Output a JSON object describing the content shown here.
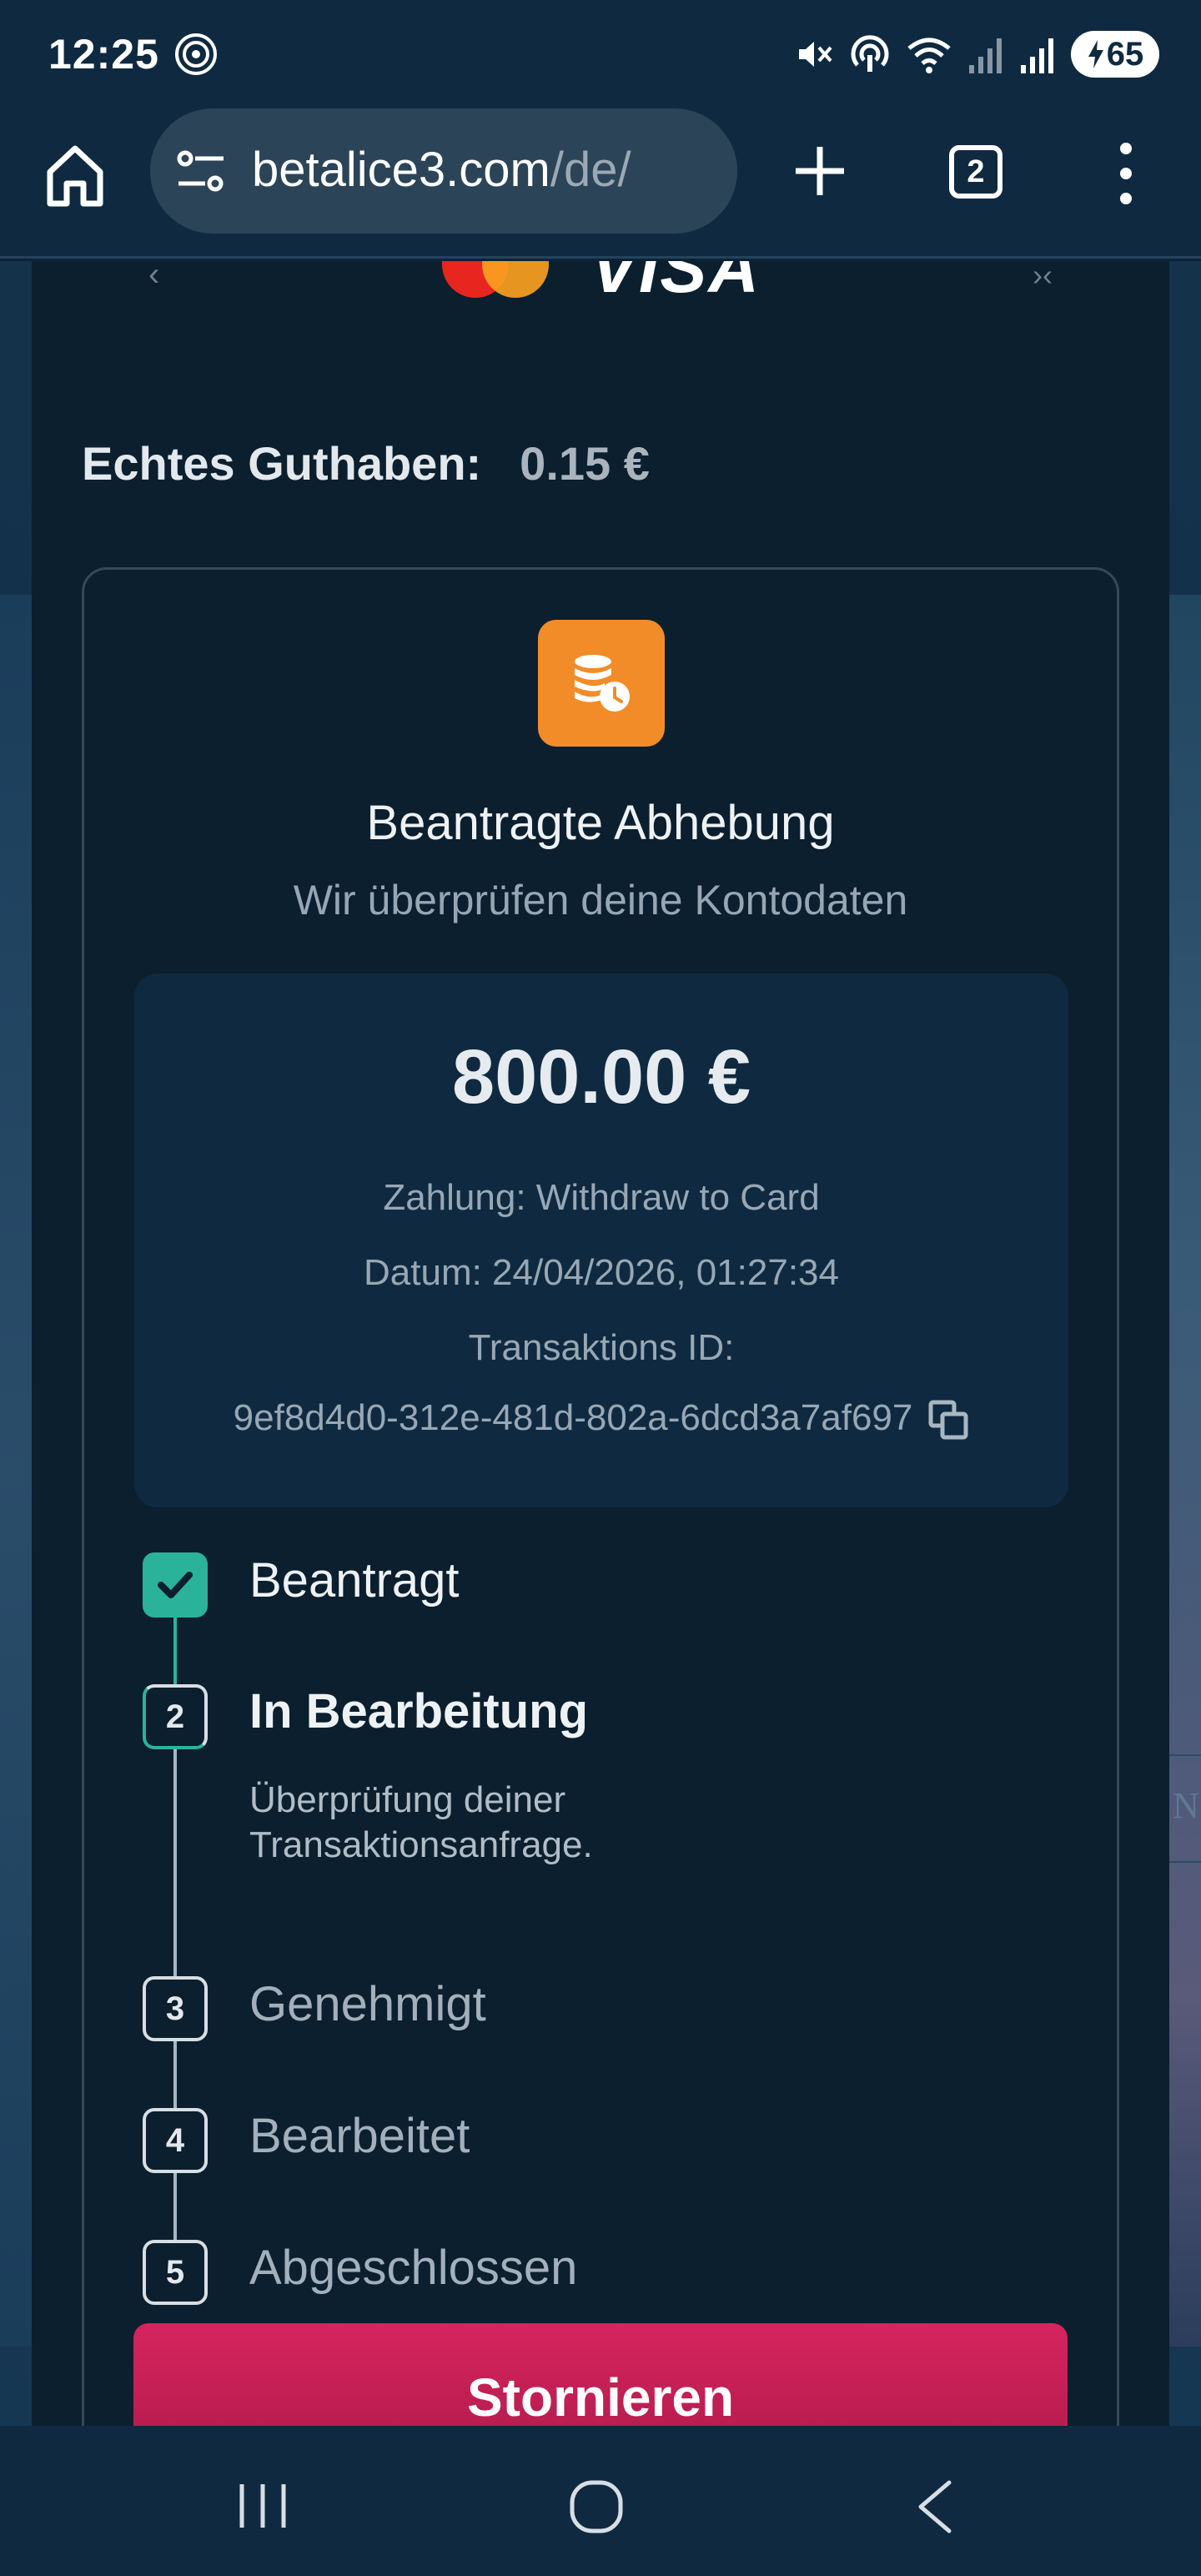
{
  "status_bar": {
    "time": "12:25",
    "battery": "65",
    "icons": [
      "hotspot-icon",
      "mute-icon",
      "nfc-icon",
      "wifi-icon",
      "signal-icon",
      "signal-r-icon",
      "battery-charging-icon"
    ]
  },
  "browser": {
    "url_domain": "betalice3.com",
    "url_path": "/de/",
    "tab_count": "2",
    "icons": [
      "home-icon",
      "site-settings-icon",
      "new-tab-icon",
      "more-menu-icon"
    ]
  },
  "header_logos": {
    "visa_text": "VISA"
  },
  "balance": {
    "label": "Echtes Guthaben:",
    "value": "0.15 €"
  },
  "withdrawal": {
    "icon": "coins-clock-icon",
    "title": "Beantragte Abhebung",
    "subtitle": "Wir überprüfen deine Kontodaten",
    "amount": "800.00 €",
    "payment": "Zahlung: Withdraw to Card",
    "date": "Datum: 24/04/2026, 01:27:34",
    "txn_label": "Transaktions ID:",
    "txn_id": "9ef8d4d0-312e-481d-802a-6dcd3a7af697"
  },
  "steps": [
    {
      "number": "",
      "label": "Beantragt",
      "state": "done"
    },
    {
      "number": "2",
      "label": "In Bearbeitung",
      "state": "active",
      "description": "Überprüfung deiner Transaktionsanfrage."
    },
    {
      "number": "3",
      "label": "Genehmigt",
      "state": "pending"
    },
    {
      "number": "4",
      "label": "Bearbeitet",
      "state": "pending"
    },
    {
      "number": "5",
      "label": "Abgeschlossen",
      "state": "pending"
    }
  ],
  "cancel_button": "Stornieren",
  "colors": {
    "accent_orange": "#f28c28",
    "success_teal": "#2ab39a",
    "cancel_pink": "#c8205a",
    "panel_bg": "#0b1f2e"
  }
}
